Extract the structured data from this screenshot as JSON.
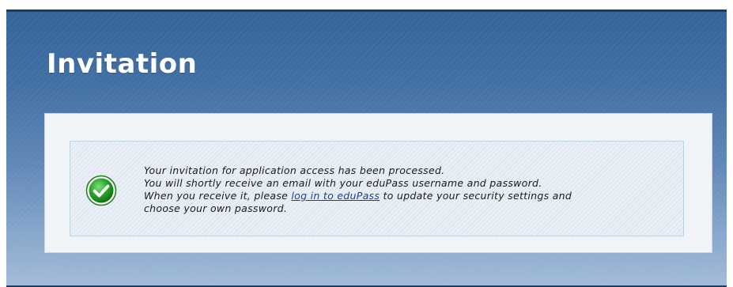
{
  "header": {
    "title": "Invitation"
  },
  "message": {
    "icon": "check-circle-icon",
    "line1": "Your invitation for application access has been processed.",
    "line2": "You will shortly receive an email with your eduPass username and password.",
    "line3_before": "When you receive it, please ",
    "login_link": "log in to eduPass",
    "line3_after": " to update your security settings and",
    "line4": "choose your own password."
  },
  "colors": {
    "header_bg": "#3f6da1",
    "success_green": "#2aa52a",
    "link": "#1b3f9a"
  }
}
